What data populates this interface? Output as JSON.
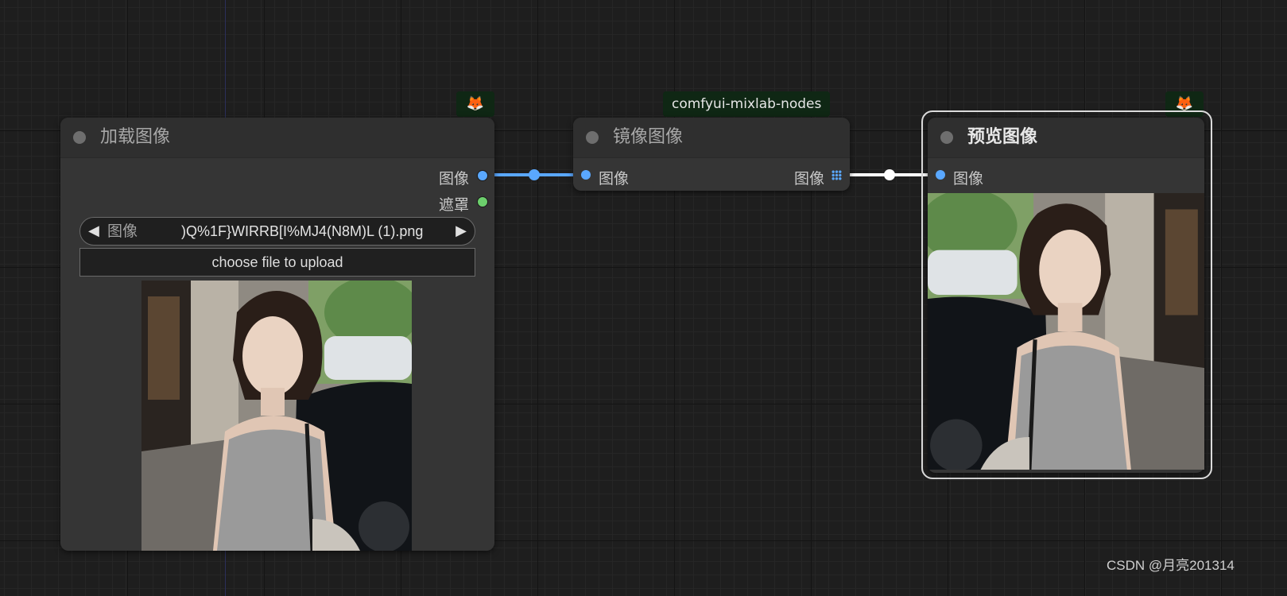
{
  "nodes": {
    "load_image": {
      "title": "加载图像",
      "outputs": {
        "image": "图像",
        "mask": "遮罩"
      },
      "widget": {
        "label": "图像",
        "value": ")Q%1F}WIRRB[I%MJ4(N8M)L (1).png",
        "prev_glyph": "◀",
        "next_glyph": "▶"
      },
      "upload_button": "choose file to upload"
    },
    "mirror_image": {
      "title": "镜像图像",
      "badge": "comfyui-mixlab-nodes",
      "input": "图像",
      "output": "图像"
    },
    "preview_image": {
      "title": "预览图像",
      "input": "图像"
    }
  },
  "badges": {
    "fox_icon": "fox-icon",
    "fox_glyph": "🦊"
  },
  "colors": {
    "image_slot": "#5aa8ff",
    "mask_slot": "#6ccf6c",
    "selected_link": "#ffffff",
    "badge_bg": "#0f2714"
  },
  "watermark": "CSDN @月亮201314"
}
